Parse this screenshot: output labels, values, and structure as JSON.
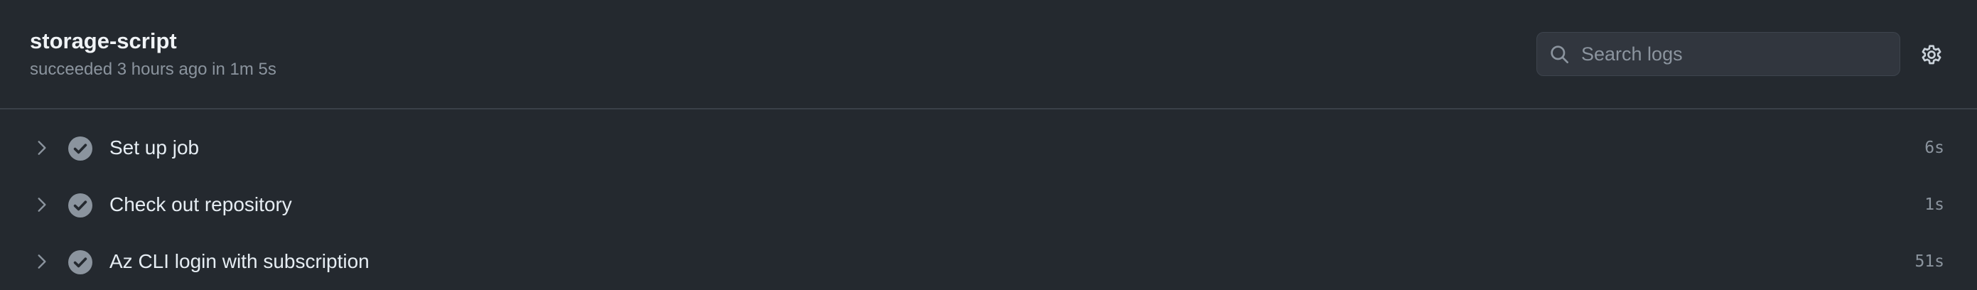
{
  "job": {
    "title": "storage-script",
    "meta": "succeeded 3 hours ago in 1m 5s"
  },
  "search": {
    "placeholder": "Search logs",
    "icon": "search-icon"
  },
  "settings": {
    "icon": "gear-icon"
  },
  "colors": {
    "background": "#24292f",
    "status_success_icon": "#8b949e",
    "text_primary": "#e6edf3",
    "text_muted": "#8b949e"
  },
  "steps": [
    {
      "label": "Set up job",
      "duration": "6s",
      "status": "succeeded"
    },
    {
      "label": "Check out repository",
      "duration": "1s",
      "status": "succeeded"
    },
    {
      "label": "Az CLI login with subscription",
      "duration": "51s",
      "status": "succeeded"
    }
  ]
}
